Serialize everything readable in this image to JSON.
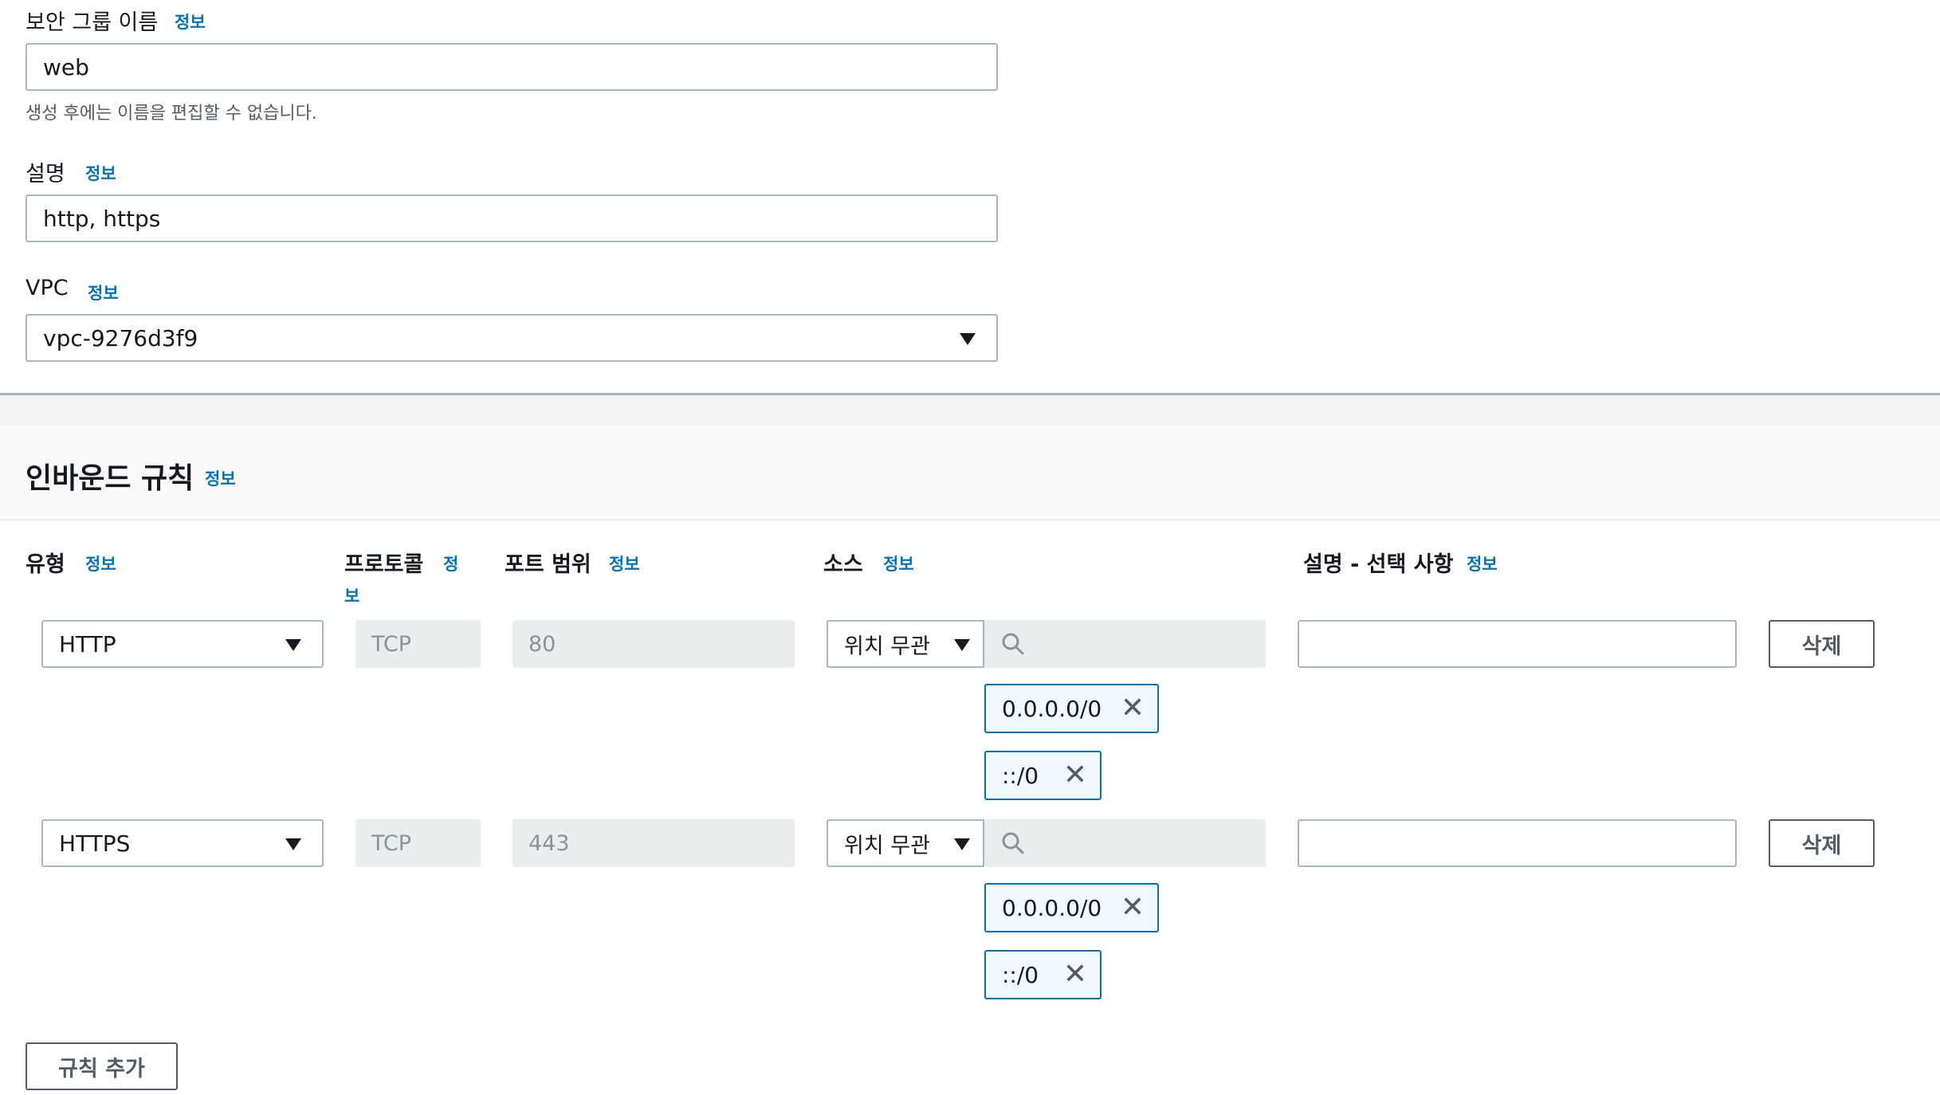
{
  "group_name": {
    "label": "보안 그룹 이름",
    "info": "정보",
    "value": "web",
    "hint": "생성 후에는 이름을 편집할 수 없습니다."
  },
  "description": {
    "label": "설명",
    "info": "정보",
    "value": "http, https"
  },
  "vpc": {
    "label": "VPC",
    "info": "정보",
    "value": "vpc-9276d3f9"
  },
  "inbound": {
    "title": "인바운드 규칙",
    "info": "정보",
    "columns": {
      "type": "유형",
      "type_info": "정보",
      "protocol": "프로토콜",
      "protocol_info_1": "정",
      "protocol_info_2": "보",
      "port": "포트 범위",
      "port_info": "정보",
      "source": "소스",
      "source_info": "정보",
      "desc": "설명 - 선택 사항",
      "desc_info": "정보"
    },
    "rules": [
      {
        "type": "HTTP",
        "protocol": "TCP",
        "port": "80",
        "source_select": "위치 무관",
        "cidrs": [
          "0.0.0.0/0",
          "::/0"
        ],
        "delete_label": "삭제"
      },
      {
        "type": "HTTPS",
        "protocol": "TCP",
        "port": "443",
        "source_select": "위치 무관",
        "cidrs": [
          "0.0.0.0/0",
          "::/0"
        ],
        "delete_label": "삭제"
      }
    ],
    "add_rule_label": "규칙 추가"
  },
  "icons": {
    "dropdown": "caret-down-icon",
    "search": "search-icon",
    "remove": "close-icon"
  }
}
